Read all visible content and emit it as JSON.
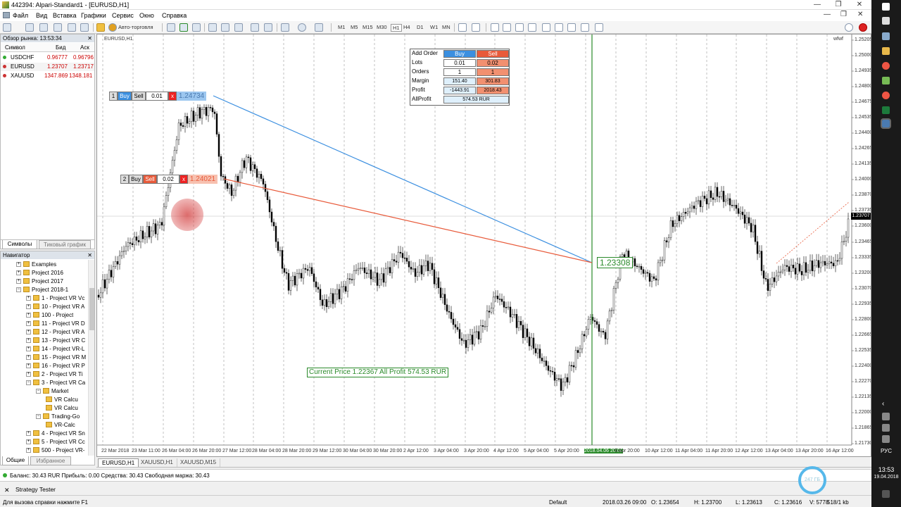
{
  "window": {
    "title": "442394: Alpari-Standard1 - [EURUSD,H1]",
    "minimize": "—",
    "maximize": "❐",
    "close": "✕"
  },
  "menu": {
    "items": [
      "Файл",
      "Вид",
      "Вставка",
      "Графики",
      "Сервис",
      "Окно",
      "Справка"
    ]
  },
  "toolbar": {
    "autotrade_label": "Авто-торговля",
    "timeframes": [
      "M1",
      "M5",
      "M15",
      "M30",
      "H1",
      "H4",
      "D1",
      "W1",
      "MN"
    ]
  },
  "market_watch": {
    "title": "Обзор рынка: 13:53:34",
    "col_symbol": "Символ",
    "col_bid": "Бид",
    "col_ask": "Аск",
    "rows": [
      {
        "symbol": "USDCHF",
        "bid": "0.96777",
        "ask": "0.96796"
      },
      {
        "symbol": "EURUSD",
        "bid": "1.23707",
        "ask": "1.23717"
      },
      {
        "symbol": "XAUUSD",
        "bid": "1347.869",
        "ask": "1348.181"
      }
    ],
    "tab_symbols": "Символы",
    "tab_tick": "Тиковый график"
  },
  "navigator": {
    "title": "Навигатор",
    "items": [
      {
        "label": "Examples",
        "level": 1
      },
      {
        "label": "Project 2016",
        "level": 1
      },
      {
        "label": "Project 2017",
        "level": 1
      },
      {
        "label": "Project 2018-1",
        "level": 1
      },
      {
        "label": "1 - Project VR Vc",
        "level": 2
      },
      {
        "label": "10 - Project VR A",
        "level": 2
      },
      {
        "label": "100 - Project",
        "level": 2
      },
      {
        "label": "11 - Project VR D",
        "level": 2
      },
      {
        "label": "12 - Project VR A",
        "level": 2
      },
      {
        "label": "13 - Project VR C",
        "level": 2
      },
      {
        "label": "14 - Project VR-L",
        "level": 2
      },
      {
        "label": "15 - Project VR M",
        "level": 2
      },
      {
        "label": "16 - Project VR P",
        "level": 2
      },
      {
        "label": "2 - Project VR Ti",
        "level": 2
      },
      {
        "label": "3 - Project VR Ca",
        "level": 2
      },
      {
        "label": "Market",
        "level": 3
      },
      {
        "label": "VR Calcu",
        "level": 4
      },
      {
        "label": "VR Calcu",
        "level": 4
      },
      {
        "label": "Trading-Go",
        "level": 3
      },
      {
        "label": "VR-Calc",
        "level": 4
      },
      {
        "label": "4 - Project VR Sn",
        "level": 2
      },
      {
        "label": "5 - Project VR Cc",
        "level": 2
      },
      {
        "label": "500 - Project VR-",
        "level": 2
      }
    ],
    "tab_general": "Общие",
    "tab_favorites": "Избранное"
  },
  "chart": {
    "symbol_label": "EURUSD,H1",
    "corner_label": "wfwf",
    "order_panel": {
      "add_order": "Add Order",
      "buy": "Buy",
      "sell": "Sell",
      "lots_label": "Lots",
      "lots_buy": "0.01",
      "lots_sell": "0.02",
      "orders_label": "Orders",
      "orders_buy": "1",
      "orders_sell": "1",
      "margin_label": "Margin",
      "margin_buy": "151.40",
      "margin_sell": "301.83",
      "profit_label": "Profit",
      "profit_buy": "-1443.91",
      "profit_sell": "2018.43",
      "allprofit_label": "AllProfit",
      "allprofit_value": "574.53 RUR"
    },
    "trade1": {
      "num": "1",
      "buy": "Buy",
      "sell": "Sell",
      "lot": "0.01",
      "x": "x",
      "price": "1.24734"
    },
    "trade2": {
      "num": "2",
      "buy": "Buy",
      "sell": "Sell",
      "lot": "0.02",
      "x": "x",
      "price": "1.24021"
    },
    "target_price": "1.23308",
    "current_price_label": "Current Price 1.22367 All Profit 574.53 RUR",
    "current_price_tag": "1.23707",
    "price_axis": [
      "1.25205",
      "1.25000",
      "1.24935",
      "1.24800",
      "1.24675",
      "1.24535",
      "1.24400",
      "1.24265",
      "1.24135",
      "1.24000",
      "1.23870",
      "1.23735",
      "1.23600",
      "1.23465",
      "1.23335",
      "1.23200",
      "1.23070",
      "1.22935",
      "1.22800",
      "1.22665",
      "1.22535",
      "1.22400",
      "1.22270",
      "1.22135",
      "1.22000",
      "1.21865",
      "1.21730"
    ],
    "time_axis": [
      "22 Mar 2018",
      "23 Mar 11:00",
      "26 Mar 04:00",
      "26 Mar 20:00",
      "27 Mar 12:00",
      "28 Mar 04:00",
      "28 Mar 20:00",
      "29 Mar 12:00",
      "30 Mar 04:00",
      "30 Mar 20:00",
      "2 Apr 12:00",
      "3 Apr 04:00",
      "3 Apr 20:00",
      "4 Apr 12:00",
      "5 Apr 04:00",
      "5 Apr 20:00",
      "2018.04.06 20:00",
      "9 Apr 20:00",
      "10 Apr 12:00",
      "11 Apr 04:00",
      "11 Apr 20:00",
      "12 Apr 12:00",
      "13 Apr 04:00",
      "13 Apr 20:00",
      "16 Apr 12:00"
    ]
  },
  "chart_tabs": [
    "EURUSD,H1",
    "XAUUSD,H1",
    "XAUUSD,M15"
  ],
  "terminal": {
    "balance_line": "Баланс: 30.43 RUR  Прибыль: 0.00  Средства: 30.43  Свободная маржа: 30.43"
  },
  "strategy_tester": "Strategy Tester",
  "status_bar": {
    "help": "Для вызова справки нажмите F1",
    "profile": "Default",
    "datetime": "2018.03.26 09:00",
    "open": "O: 1.23654",
    "high": "H: 1.23700",
    "low": "L: 1.23613",
    "close": "C: 1.23616",
    "volume": "V: 5778",
    "traffic": "518/1 kb",
    "circle": "247 ГБ"
  },
  "taskbar": {
    "lang": "РУС",
    "time": "13:53",
    "date": "19.04.2018"
  }
}
